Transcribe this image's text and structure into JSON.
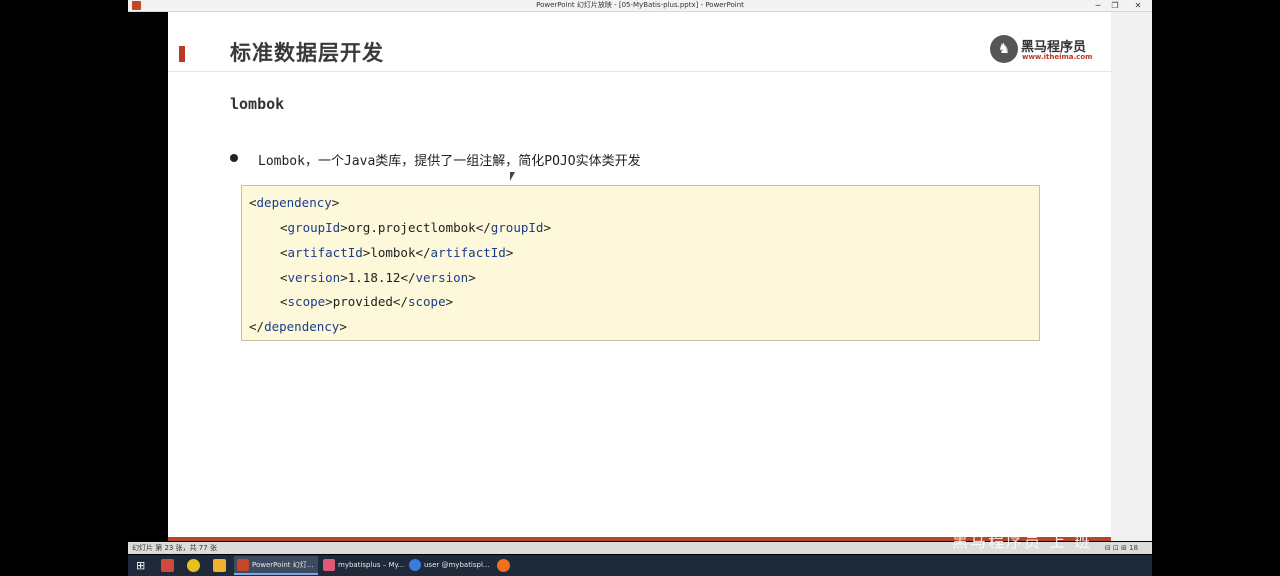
{
  "window": {
    "title": "PowerPoint 幻灯片放映 - [05-MyBatis-plus.pptx] - PowerPoint",
    "minimize": "─",
    "maximize": "❐",
    "close": "✕"
  },
  "slide": {
    "heading": "标准数据层开发",
    "subheading": "lombok",
    "logo": {
      "name": "黑马程序员",
      "url": "www.itheima.com",
      "mark": "♞"
    },
    "bullet": "Lombok，一个Java类库，提供了一组注解，简化POJO实体类开发",
    "code": {
      "open_tag": "dependency",
      "lines": [
        {
          "tag": "groupId",
          "value": "org.projectlombok"
        },
        {
          "tag": "artifactId",
          "value": "lombok"
        },
        {
          "tag": "version",
          "value": "1.18.12"
        },
        {
          "tag": "scope",
          "value": "provided"
        }
      ],
      "close_tag": "dependency"
    }
  },
  "statusbar": {
    "text": "幻灯片 第 23 张，共 77 张",
    "views": "⊟  ⊡  ⊞   18"
  },
  "taskbar": {
    "start_icon": "windows-icon",
    "tasks": [
      {
        "label": "PowerPoint 幻灯...",
        "color": "#c4472a",
        "active": true
      },
      {
        "label": "mybatisplus – My...",
        "color": "#e05a78",
        "active": false
      },
      {
        "label": "user @mybatispl...",
        "color": "#3b7bd9",
        "active": false
      }
    ],
    "pinned_colors": [
      "#d04a3c",
      "#e8c020",
      "#f0b030",
      "#4a90d9",
      "#f07020"
    ]
  },
  "watermark": "黑马程序员 上 班"
}
